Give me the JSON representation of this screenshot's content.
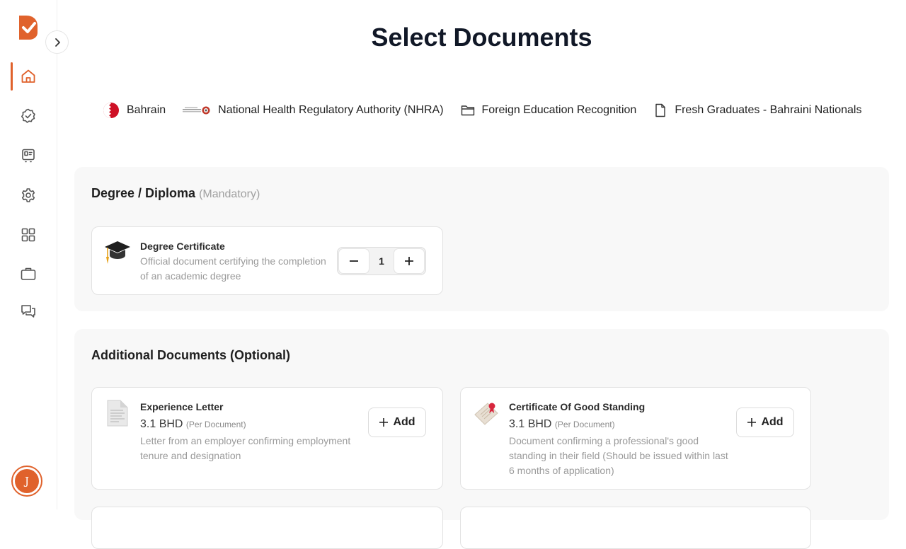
{
  "page": {
    "title": "Select Documents"
  },
  "colors": {
    "accent": "#e0622c",
    "title": "#111827",
    "muted": "#9a9a9a"
  },
  "sidebar": {
    "items": [
      {
        "icon": "home-icon",
        "active": true
      },
      {
        "icon": "badge-check-icon",
        "active": false
      },
      {
        "icon": "id-card-icon",
        "active": false
      },
      {
        "icon": "gear-icon",
        "active": false
      },
      {
        "icon": "grid-icon",
        "active": false
      },
      {
        "icon": "briefcase-icon",
        "active": false
      },
      {
        "icon": "chat-icon",
        "active": false
      }
    ],
    "avatar_initial": "J"
  },
  "breadcrumb": {
    "items": [
      {
        "label": "Bahrain",
        "icon": "bahrain-flag-icon"
      },
      {
        "label": "National Health Regulatory Authority (NHRA)",
        "icon": "nhra-logo-icon"
      },
      {
        "label": "Foreign Education Recognition",
        "icon": "folder-icon"
      },
      {
        "label": "Fresh Graduates - Bahraini Nationals",
        "icon": "file-icon"
      }
    ]
  },
  "mandatory": {
    "title": "Degree / Diploma",
    "tag": "(Mandatory)",
    "cards": [
      {
        "name": "Degree Certificate",
        "desc_line1": "Official document certifying the completion",
        "desc_line2": "of an academic degree",
        "quantity": "1",
        "icon": "graduation-cap-icon"
      }
    ]
  },
  "additional": {
    "title": "Additional Documents (Optional)",
    "add_label": "Add",
    "cards": [
      {
        "name": "Experience Letter",
        "price": "3.1 BHD",
        "per": "(Per Document)",
        "desc_line1": "Letter from an employer confirming employment",
        "desc_line2": "tenure and designation",
        "icon": "letter-document-icon"
      },
      {
        "name": "Certificate Of Good Standing",
        "price": "3.1 BHD",
        "per": "(Per Document)",
        "desc_line1": "Document confirming a professional's good",
        "desc_line2": "standing in their field (Should be issued within last",
        "desc_line3": "6 months of application)",
        "icon": "certificate-seal-icon"
      }
    ]
  }
}
